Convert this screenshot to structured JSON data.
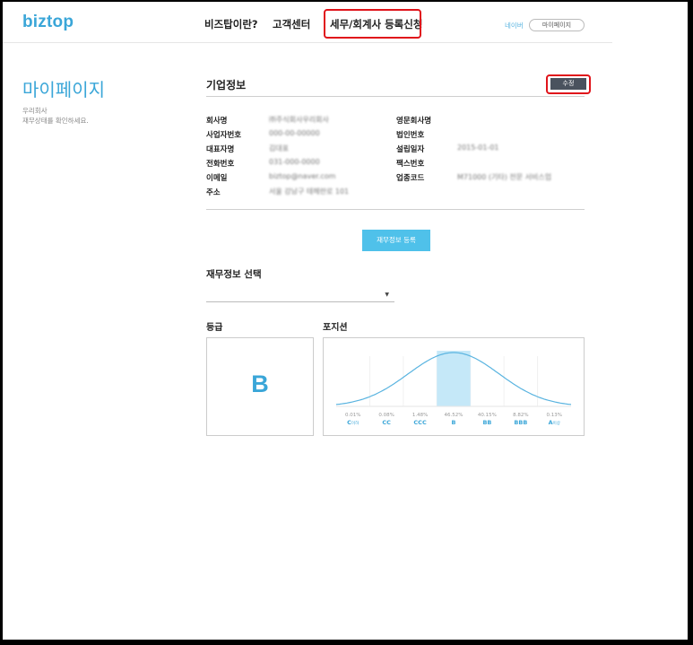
{
  "header": {
    "logo": "biztop",
    "nav": [
      "비즈탑이란?",
      "고객센터",
      "세무/회계사 등록신청"
    ],
    "naver": "네이버",
    "mypage": "마이페이지"
  },
  "sidebar": {
    "title": "마이페이지",
    "company": "우리회사",
    "desc": "재무상태를 확인하세요."
  },
  "company_info": {
    "title": "기업정보",
    "edit_label": "수정",
    "left_fields": [
      {
        "label": "회사명",
        "value": "㈜주식회사우리회사"
      },
      {
        "label": "사업자번호",
        "value": "000-00-00000"
      },
      {
        "label": "대표자명",
        "value": "김대표"
      },
      {
        "label": "전화번호",
        "value": "031-000-0000"
      },
      {
        "label": "이메일",
        "value": "biztop@naver.com"
      },
      {
        "label": "주소",
        "value": "서울 강남구 테헤란로 101"
      }
    ],
    "right_fields": [
      {
        "label": "영문회사명",
        "value": ""
      },
      {
        "label": "법인번호",
        "value": ""
      },
      {
        "label": "설립일자",
        "value": "2015-01-01"
      },
      {
        "label": "팩스번호",
        "value": ""
      },
      {
        "label": "업종코드",
        "value": "M71000 (기타) 전문 서비스업"
      }
    ]
  },
  "financial": {
    "register_label": "재무정보 등록",
    "select_title": "재무정보 선택",
    "select_value": ""
  },
  "grade": {
    "title": "등급",
    "value": "B"
  },
  "position": {
    "title": "포지션",
    "highlight_color": "#c5e8f8",
    "curve_color": "#5ab4e0",
    "bins": [
      {
        "pct": "0.01%",
        "grade": "C",
        "suffix": "이하"
      },
      {
        "pct": "0.08%",
        "grade": "CC",
        "suffix": ""
      },
      {
        "pct": "1.48%",
        "grade": "CCC",
        "suffix": ""
      },
      {
        "pct": "46.52%",
        "grade": "B",
        "suffix": ""
      },
      {
        "pct": "40.15%",
        "grade": "BB",
        "suffix": ""
      },
      {
        "pct": "8.82%",
        "grade": "BBB",
        "suffix": ""
      },
      {
        "pct": "0.13%",
        "grade": "A",
        "suffix": "이상"
      }
    ],
    "highlight_index": 3
  }
}
